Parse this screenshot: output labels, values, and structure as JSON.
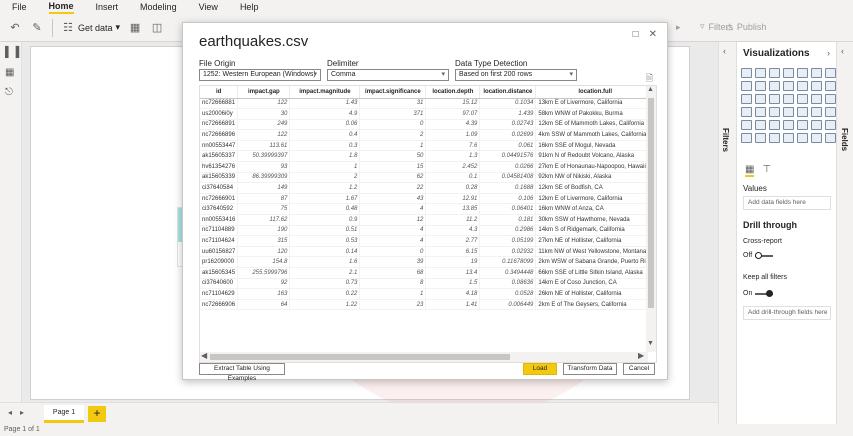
{
  "menu": [
    "File",
    "Home",
    "Insert",
    "Modeling",
    "View",
    "Help"
  ],
  "ribbon": {
    "get_data": "Get data",
    "filters": "Filters",
    "publish": "Publish"
  },
  "dialog": {
    "title": "earthquakes.csv",
    "file_origin_label": "File Origin",
    "file_origin_value": "1252: Western European (Windows)",
    "delimiter_label": "Delimiter",
    "delimiter_value": "Comma",
    "detection_label": "Data Type Detection",
    "detection_value": "Based on first 200 rows",
    "columns": [
      "id",
      "impact.gap",
      "impact.magnitude",
      "impact.significance",
      "location.depth",
      "location.distance",
      "location.full"
    ],
    "rows": [
      [
        "nc72666881",
        "122",
        "1.43",
        "31",
        "15.12",
        "0.1034",
        "13km E of Livermore, California"
      ],
      [
        "us20006i0y",
        "30",
        "4.9",
        "371",
        "97.07",
        "1.439",
        "58km WNW of Pakokku, Burma"
      ],
      [
        "nc72666891",
        "249",
        "0.06",
        "0",
        "4.39",
        "0.02743",
        "12km SE of Mammoth Lakes, California"
      ],
      [
        "nc72666896",
        "122",
        "0.4",
        "2",
        "1.09",
        "0.02699",
        "4km SSW of Mammoth Lakes, California"
      ],
      [
        "nn00553447",
        "113.61",
        "0.3",
        "1",
        "7.6",
        "0.061",
        "16km SSE of Mogul, Nevada"
      ],
      [
        "ak15605337",
        "50.39999397",
        "1.8",
        "50",
        "1.3",
        "0.04491576",
        "91km N of Redoubt Volcano, Alaska"
      ],
      [
        "hv61354276",
        "93",
        "1",
        "15",
        "2.452",
        "0.0266",
        "27km E of Honaunau-Napoopoo, Hawaii"
      ],
      [
        "ak15605339",
        "86.39999309",
        "2",
        "62",
        "0.1",
        "0.04581408",
        "92km NW of Nikiski, Alaska"
      ],
      [
        "ci37640584",
        "149",
        "1.2",
        "22",
        "0.28",
        "0.1688",
        "12km SE of Bodfish, CA"
      ],
      [
        "nc72666901",
        "87",
        "1.67",
        "43",
        "12.91",
        "0.106",
        "12km E of Livermore, California"
      ],
      [
        "ci37640592",
        "75",
        "0.48",
        "4",
        "13.85",
        "0.06401",
        "16km WNW of Anza, CA"
      ],
      [
        "nn00553416",
        "117.62",
        "0.9",
        "12",
        "11.2",
        "0.181",
        "30km SSW of Hawthorne, Nevada"
      ],
      [
        "nc71104889",
        "190",
        "0.51",
        "4",
        "4.3",
        "0.2986",
        "14km S of Ridgemark, California"
      ],
      [
        "nc71104624",
        "315",
        "0.53",
        "4",
        "2.77",
        "0.05199",
        "27km NE of Hollister, California"
      ],
      [
        "uu60156827",
        "120",
        "0.14",
        "0",
        "6.15",
        "0.02932",
        "11km NW of West Yellowstone, Montana"
      ],
      [
        "pr16209000",
        "154.8",
        "1.6",
        "39",
        "19",
        "0.11678099",
        "2km WSW of Sabana Grande, Puerto Rico"
      ],
      [
        "ak15605345",
        "255.5999796",
        "2.1",
        "68",
        "13.4",
        "0.3494448",
        "66km SSE of Little Sitkin Island, Alaska"
      ],
      [
        "ci37640600",
        "92",
        "0.73",
        "8",
        "1.5",
        "0.08636",
        "14km E of Coso Junction, CA"
      ],
      [
        "nc71104629",
        "163",
        "0.22",
        "1",
        "4.18",
        "0.0528",
        "26km NE of Hollister, California"
      ],
      [
        "nc72666906",
        "64",
        "1.22",
        "23",
        "1.41",
        "0.006449",
        "2km E of The Geysers, California"
      ]
    ],
    "btn_extract": "Extract Table Using Examples",
    "btn_load": "Load",
    "btn_transform": "Transform Data",
    "btn_cancel": "Cancel"
  },
  "pages": {
    "tab": "Page 1",
    "add": "+"
  },
  "status": "Page 1 of 1",
  "filters_pane": {
    "label": "Filters"
  },
  "fields_pane": {
    "label": "Fields"
  },
  "viz": {
    "title": "Visualizations",
    "values_label": "Values",
    "values_placeholder": "Add data fields here",
    "drill_title": "Drill through",
    "cross_report": "Cross-report",
    "cross_report_state": "Off",
    "keep_filters": "Keep all filters",
    "keep_filters_state": "On",
    "drill_placeholder": "Add drill-through fields here"
  },
  "colors": {
    "accent": "#f2c811",
    "watermark": "#e98c8c"
  }
}
